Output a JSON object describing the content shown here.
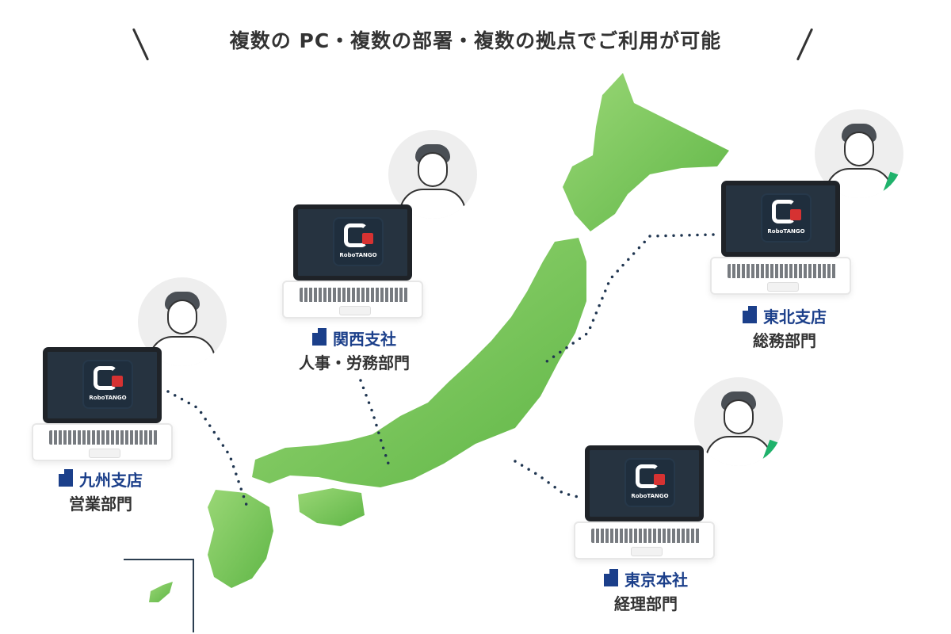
{
  "header": {
    "title": "複数の PC・複数の部署・複数の拠点でご利用が可能"
  },
  "branches": [
    {
      "name": "関西支社",
      "department": "人事・労務部門"
    },
    {
      "name": "東北支店",
      "department": "総務部門"
    },
    {
      "name": "九州支店",
      "department": "営業部門"
    },
    {
      "name": "東京本社",
      "department": "経理部門"
    }
  ],
  "laptop": {
    "logo_text": "RoboTANGO"
  },
  "colors": {
    "map_green": "#7dc85a",
    "branch_blue": "#1b3f8a",
    "dot_blue": "#1f3550",
    "accent_red": "#d63232"
  },
  "icons": {
    "building": "building-icon",
    "person": "person-avatar",
    "laptop": "laptop-icon"
  }
}
